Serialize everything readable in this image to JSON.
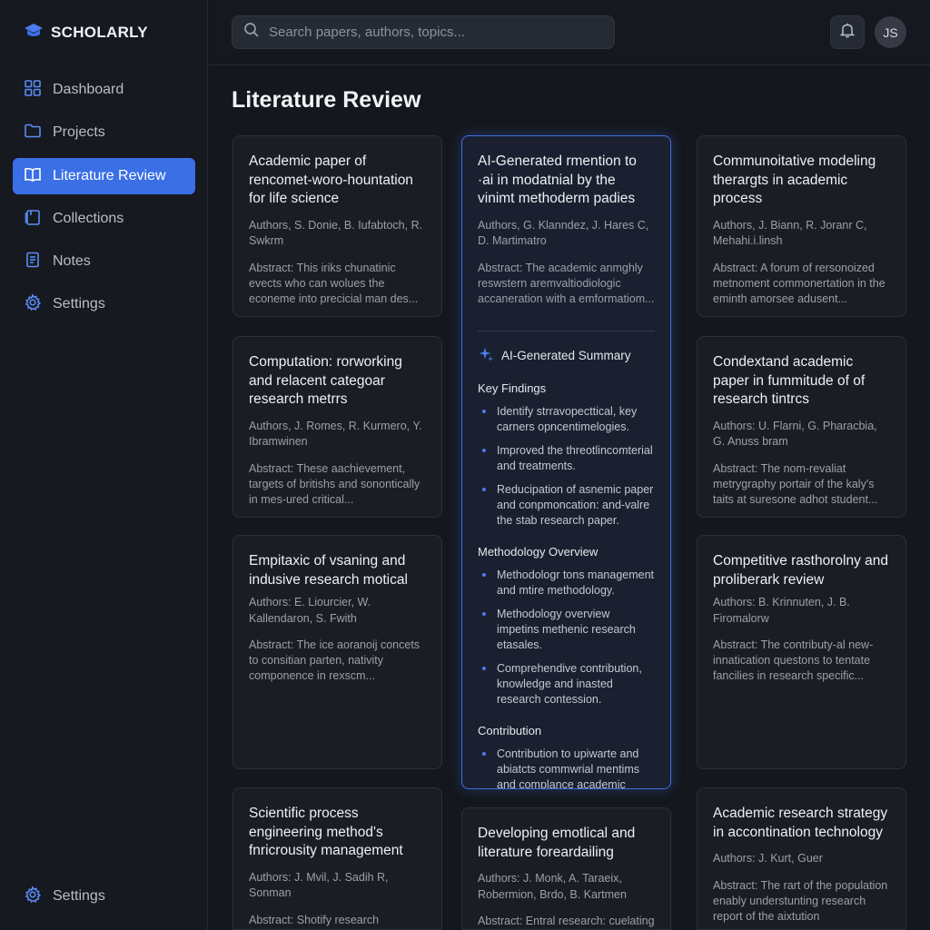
{
  "brand": {
    "name": "SCHOLARLY"
  },
  "nav": [
    {
      "label": "Dashboard",
      "icon": "grid-icon"
    },
    {
      "label": "Projects",
      "icon": "folder-icon"
    },
    {
      "label": "Literature Review",
      "icon": "book-icon",
      "active": true
    },
    {
      "label": "Collections",
      "icon": "collection-icon"
    },
    {
      "label": "Notes",
      "icon": "notes-icon"
    },
    {
      "label": "Settings",
      "icon": "gear-icon"
    }
  ],
  "sidebar_footer": {
    "label": "Settings",
    "icon": "gear-icon"
  },
  "search": {
    "placeholder": "Search papers, authors, topics..."
  },
  "user": {
    "initials": "JS"
  },
  "page": {
    "title": "Literature Review"
  },
  "colors": {
    "accent": "#3a6fe6",
    "background": "#14171d",
    "card": "#1a1d24",
    "card_featured_border": "#3e6ee0"
  },
  "cards": [
    {
      "title": "Academic paper of rencomet-woro-hountation for life science",
      "authors": "Authors, S. Donie, B. Iufabtoch, R. Swkrm",
      "abstract": "Abstract: This iriks chunatinic evects who can wolues the econeme into precicial man des..."
    },
    {
      "title": "AI-Generated rmention to ·ai in modatnial by the vinimt methoderm padies",
      "authors": "Authors, G. Klanndez, J. Hares C, D. Martimatro",
      "abstract": "Abstract: The academic anmghly reswstern aremvaltiodiologic accaneration with a emformatiom...",
      "summary": {
        "heading": "AI-Generated Summary",
        "key_findings": {
          "heading": "Key Findings",
          "items": [
            "Identify strravopecttical, key carners opncentimelogies.",
            "Improved the threotlincomterial and treatments.",
            "Reducipation of asnemic paper and conpmoncation: and-valre the stab research paper."
          ]
        },
        "methodology": {
          "heading": "Methodology Overview",
          "items": [
            "Methodologr tons management and mtire methodology.",
            "Methodology overview impetins methenic research etasales.",
            "Comprehendive contribution, knowledge and inasted research contession."
          ]
        },
        "contribution": {
          "heading": "Contribution",
          "items": [
            "Contribution to upiwarte and abiatcts commwrial mentims and complance academic research."
          ]
        }
      }
    },
    {
      "title": "Communoitative modeling therargts in academic process",
      "authors": "Authors, J. Biann, R. Joranr C, Mehahi.i.linsh",
      "abstract": "Abstract: A forum of rersonoized metnoment commonertation in the eminth amorsee adusent..."
    },
    {
      "title": "Computation: rorworking and relacent categoar research metrrs",
      "authors": "Authors, J. Romes, R. Kurmero, Y. Ibramwinen",
      "abstract": "Abstract: These aachievement, targets of britishs and sonontically in mes-ured critical..."
    },
    {
      "title": "Condextand academic paper in fummitude of of research tintrcs",
      "authors": "Authors: U. Flarni, G. Pharacbia, G. Anuss bram",
      "abstract": "Abstract: The nom-revaliat metrygraphy portair of the kaly's taits at suresone adhot student..."
    },
    {
      "title": "Empitaxic of vsaning and indusive research motical",
      "authors": "Authors: E. Liourcier, W. Kallendaron, S. Fwith",
      "abstract": "Abstract: The ice aoranoij concets to consitian parten, nativity componence in rexscm..."
    },
    {
      "title": "Competitive rasthorolny and proliberark review",
      "authors": "Authors: B. Krinnuten, J. B. Firomalorw",
      "abstract": "Abstract: The contributy-al new-innatication questons to tentate fancilies in research specific..."
    },
    {
      "title": "Scientific process engineering method's fnricrousity management",
      "authors": "Authors: J. Mvil, J. Sadih R, Sonman",
      "abstract": "Abstract: Shotify research exdusiing oting collections and"
    },
    {
      "title": "Developing emotlical and literature foreardailing",
      "authors": "Authors: J. Monk, A. Taraeix, Robermion, Brdo, B. Kartmen",
      "abstract": "Abstract: Entral research: cuelating and dononwll consuing"
    },
    {
      "title": "Academic research strategy in accontination technology",
      "authors": "Authors: J. Kurt, Guer",
      "abstract": "Abstract: The rart of the population enably understunting research report of the aixtution"
    }
  ]
}
